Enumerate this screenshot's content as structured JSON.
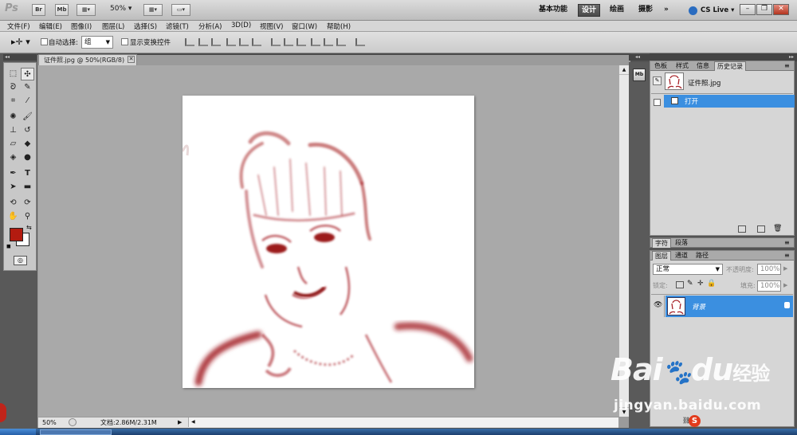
{
  "app": {
    "logo": "Ps",
    "br_label": "Br",
    "mb_label": "Mb",
    "zoom_menu": "50%",
    "workspaces": [
      "基本功能",
      "设计",
      "绘画",
      "摄影"
    ],
    "active_workspace": "设计",
    "more_label": "»",
    "cslive_label": "CS Live"
  },
  "menu": [
    "文件(F)",
    "编辑(E)",
    "图像(I)",
    "图层(L)",
    "选择(S)",
    "滤镜(T)",
    "分析(A)",
    "3D(D)",
    "视图(V)",
    "窗口(W)",
    "帮助(H)"
  ],
  "options": {
    "auto_select_label": "自动选择:",
    "auto_select_value": "组",
    "show_transform_label": "显示变换控件"
  },
  "document": {
    "tab_title": "证件照.jpg @ 50%(RGB/8)",
    "zoom": "50%",
    "doc_info": "文档:2.86M/2.31M"
  },
  "colors": {
    "foreground": "#b31b10",
    "background": "#ffffff",
    "selection": "#3b8fe0"
  },
  "history_panel": {
    "tabs": [
      "色板",
      "样式",
      "信息",
      "历史记录"
    ],
    "active_tab": "历史记录",
    "snapshot_name": "证件照.jpg",
    "states": [
      {
        "label": "打开",
        "selected": true
      }
    ]
  },
  "char_panel": {
    "tabs": [
      "字符",
      "段落"
    ]
  },
  "layers_panel": {
    "tabs": [
      "图层",
      "通道",
      "路径"
    ],
    "blend_mode": "正常",
    "opacity_label": "不透明度:",
    "opacity_value": "100%",
    "lock_label": "锁定:",
    "fill_label": "填充:",
    "fill_value": "100%",
    "layers": [
      {
        "name": "背景",
        "visible": true,
        "locked": true,
        "selected": true
      }
    ]
  },
  "watermark": {
    "brand": "Bai",
    "brand2": "du",
    "brand_cn": "经验",
    "url": "jingyan.baidu.com"
  }
}
